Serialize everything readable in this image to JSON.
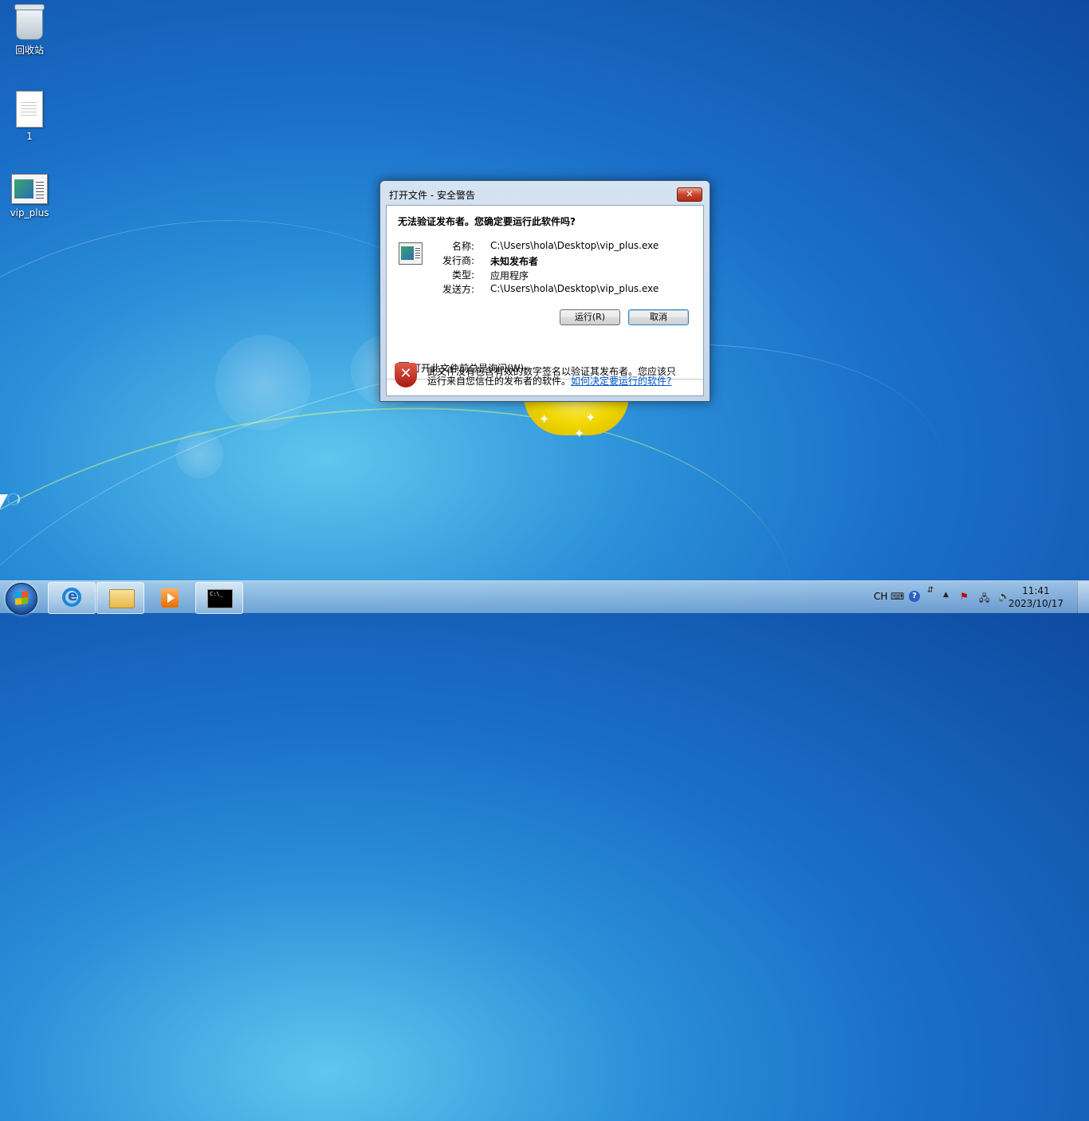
{
  "desktop": {
    "icons": [
      {
        "label": "回收站",
        "icon": "recycle-bin-icon"
      },
      {
        "label": "1",
        "icon": "text-document-icon"
      },
      {
        "label": "vip_plus",
        "icon": "exe-file-icon"
      }
    ]
  },
  "dialog": {
    "title": "打开文件 - 安全警告",
    "question": "无法验证发布者。您确定要运行此软件吗?",
    "properties": [
      {
        "key": "名称:",
        "value": "C:\\Users\\hola\\Desktop\\vip_plus.exe"
      },
      {
        "key": "发行商:",
        "value": "未知发布者"
      },
      {
        "key": "类型:",
        "value": "应用程序"
      },
      {
        "key": "发送方:",
        "value": "C:\\Users\\hola\\Desktop\\vip_plus.exe"
      }
    ],
    "run_label": "运行(R)",
    "cancel_label": "取消",
    "always_ask_label": "打开此文件前总是询问(W)",
    "always_ask_checked": true,
    "warning_text": "此文件没有包含有效的数字签名以验证其发布者。您应该只运行来自您信任的发布者的软件。",
    "warning_link": "如何决定要运行的软件?",
    "close_glyph": "✕"
  },
  "taskbar": {
    "pinned": [
      {
        "icon": "internet-explorer-icon"
      },
      {
        "icon": "file-explorer-icon"
      },
      {
        "icon": "media-player-icon"
      },
      {
        "icon": "command-prompt-icon",
        "text": "C:\\_"
      }
    ],
    "tray": {
      "language": "CH",
      "time": "11:41",
      "date": "2023/10/17"
    }
  },
  "colors": {
    "link": "#0055cc",
    "shield": "#c0281c",
    "dialog_border": "#3d5878"
  }
}
